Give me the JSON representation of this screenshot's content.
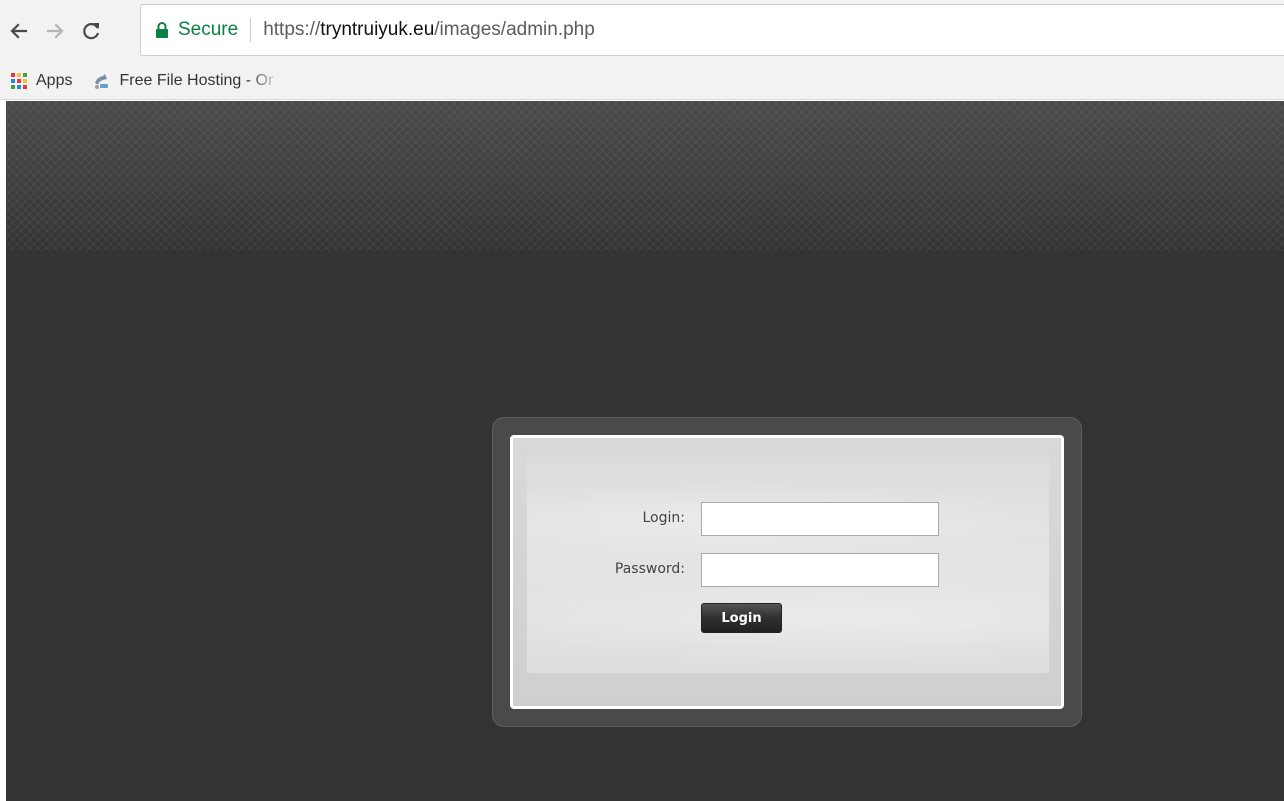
{
  "browser": {
    "nav": {
      "back_icon": "back-arrow-icon",
      "forward_icon": "forward-arrow-icon",
      "reload_icon": "reload-icon"
    },
    "address_bar": {
      "security_label": "Secure",
      "url_scheme": "https://",
      "url_host": "tryntruiyuk.eu",
      "url_path": "/images/admin.php",
      "lock_icon": "lock-icon",
      "secure_color": "#0b8043"
    },
    "bookmarks": [
      {
        "label": "Apps",
        "icon": "apps-grid-icon"
      },
      {
        "label": "Free File Hosting - Or",
        "icon": "file-hosting-icon"
      }
    ]
  },
  "page": {
    "background_color": "#333333",
    "login_form": {
      "login_label": "Login:",
      "login_value": "",
      "password_label": "Password:",
      "password_value": "",
      "submit_label": "Login"
    }
  }
}
